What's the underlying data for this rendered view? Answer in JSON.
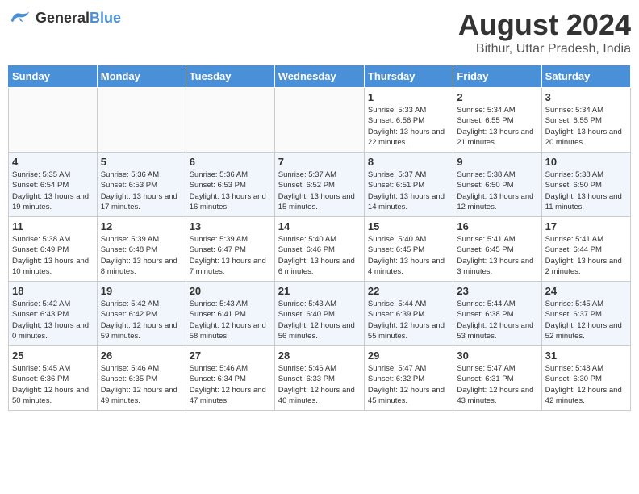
{
  "header": {
    "logo_general": "General",
    "logo_blue": "Blue",
    "month": "August 2024",
    "location": "Bithur, Uttar Pradesh, India"
  },
  "days_of_week": [
    "Sunday",
    "Monday",
    "Tuesday",
    "Wednesday",
    "Thursday",
    "Friday",
    "Saturday"
  ],
  "weeks": [
    [
      {
        "day": "",
        "info": ""
      },
      {
        "day": "",
        "info": ""
      },
      {
        "day": "",
        "info": ""
      },
      {
        "day": "",
        "info": ""
      },
      {
        "day": "1",
        "info": "Sunrise: 5:33 AM\nSunset: 6:56 PM\nDaylight: 13 hours\nand 22 minutes."
      },
      {
        "day": "2",
        "info": "Sunrise: 5:34 AM\nSunset: 6:55 PM\nDaylight: 13 hours\nand 21 minutes."
      },
      {
        "day": "3",
        "info": "Sunrise: 5:34 AM\nSunset: 6:55 PM\nDaylight: 13 hours\nand 20 minutes."
      }
    ],
    [
      {
        "day": "4",
        "info": "Sunrise: 5:35 AM\nSunset: 6:54 PM\nDaylight: 13 hours\nand 19 minutes."
      },
      {
        "day": "5",
        "info": "Sunrise: 5:36 AM\nSunset: 6:53 PM\nDaylight: 13 hours\nand 17 minutes."
      },
      {
        "day": "6",
        "info": "Sunrise: 5:36 AM\nSunset: 6:53 PM\nDaylight: 13 hours\nand 16 minutes."
      },
      {
        "day": "7",
        "info": "Sunrise: 5:37 AM\nSunset: 6:52 PM\nDaylight: 13 hours\nand 15 minutes."
      },
      {
        "day": "8",
        "info": "Sunrise: 5:37 AM\nSunset: 6:51 PM\nDaylight: 13 hours\nand 14 minutes."
      },
      {
        "day": "9",
        "info": "Sunrise: 5:38 AM\nSunset: 6:50 PM\nDaylight: 13 hours\nand 12 minutes."
      },
      {
        "day": "10",
        "info": "Sunrise: 5:38 AM\nSunset: 6:50 PM\nDaylight: 13 hours\nand 11 minutes."
      }
    ],
    [
      {
        "day": "11",
        "info": "Sunrise: 5:38 AM\nSunset: 6:49 PM\nDaylight: 13 hours\nand 10 minutes."
      },
      {
        "day": "12",
        "info": "Sunrise: 5:39 AM\nSunset: 6:48 PM\nDaylight: 13 hours\nand 8 minutes."
      },
      {
        "day": "13",
        "info": "Sunrise: 5:39 AM\nSunset: 6:47 PM\nDaylight: 13 hours\nand 7 minutes."
      },
      {
        "day": "14",
        "info": "Sunrise: 5:40 AM\nSunset: 6:46 PM\nDaylight: 13 hours\nand 6 minutes."
      },
      {
        "day": "15",
        "info": "Sunrise: 5:40 AM\nSunset: 6:45 PM\nDaylight: 13 hours\nand 4 minutes."
      },
      {
        "day": "16",
        "info": "Sunrise: 5:41 AM\nSunset: 6:45 PM\nDaylight: 13 hours\nand 3 minutes."
      },
      {
        "day": "17",
        "info": "Sunrise: 5:41 AM\nSunset: 6:44 PM\nDaylight: 13 hours\nand 2 minutes."
      }
    ],
    [
      {
        "day": "18",
        "info": "Sunrise: 5:42 AM\nSunset: 6:43 PM\nDaylight: 13 hours\nand 0 minutes."
      },
      {
        "day": "19",
        "info": "Sunrise: 5:42 AM\nSunset: 6:42 PM\nDaylight: 12 hours\nand 59 minutes."
      },
      {
        "day": "20",
        "info": "Sunrise: 5:43 AM\nSunset: 6:41 PM\nDaylight: 12 hours\nand 58 minutes."
      },
      {
        "day": "21",
        "info": "Sunrise: 5:43 AM\nSunset: 6:40 PM\nDaylight: 12 hours\nand 56 minutes."
      },
      {
        "day": "22",
        "info": "Sunrise: 5:44 AM\nSunset: 6:39 PM\nDaylight: 12 hours\nand 55 minutes."
      },
      {
        "day": "23",
        "info": "Sunrise: 5:44 AM\nSunset: 6:38 PM\nDaylight: 12 hours\nand 53 minutes."
      },
      {
        "day": "24",
        "info": "Sunrise: 5:45 AM\nSunset: 6:37 PM\nDaylight: 12 hours\nand 52 minutes."
      }
    ],
    [
      {
        "day": "25",
        "info": "Sunrise: 5:45 AM\nSunset: 6:36 PM\nDaylight: 12 hours\nand 50 minutes."
      },
      {
        "day": "26",
        "info": "Sunrise: 5:46 AM\nSunset: 6:35 PM\nDaylight: 12 hours\nand 49 minutes."
      },
      {
        "day": "27",
        "info": "Sunrise: 5:46 AM\nSunset: 6:34 PM\nDaylight: 12 hours\nand 47 minutes."
      },
      {
        "day": "28",
        "info": "Sunrise: 5:46 AM\nSunset: 6:33 PM\nDaylight: 12 hours\nand 46 minutes."
      },
      {
        "day": "29",
        "info": "Sunrise: 5:47 AM\nSunset: 6:32 PM\nDaylight: 12 hours\nand 45 minutes."
      },
      {
        "day": "30",
        "info": "Sunrise: 5:47 AM\nSunset: 6:31 PM\nDaylight: 12 hours\nand 43 minutes."
      },
      {
        "day": "31",
        "info": "Sunrise: 5:48 AM\nSunset: 6:30 PM\nDaylight: 12 hours\nand 42 minutes."
      }
    ]
  ]
}
